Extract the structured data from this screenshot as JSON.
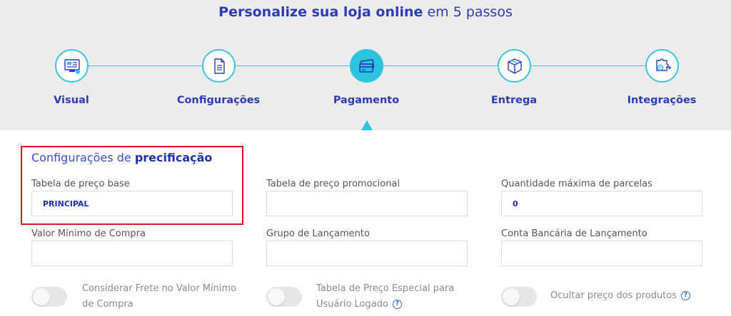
{
  "header": {
    "title_strong": "Personalize sua loja online",
    "title_light": "em 5 passos"
  },
  "steps": [
    {
      "label": "Visual",
      "icon": "visual-icon",
      "active": false
    },
    {
      "label": "Configurações",
      "icon": "document-icon",
      "active": false
    },
    {
      "label": "Pagamento",
      "icon": "payment-icon",
      "active": true
    },
    {
      "label": "Entrega",
      "icon": "box-icon",
      "active": false
    },
    {
      "label": "Integrações",
      "icon": "puzzle-gear-icon",
      "active": false
    }
  ],
  "section": {
    "title_light": "Configurações de",
    "title_strong": "precificação"
  },
  "fields": {
    "tabela_base": {
      "label": "Tabela de preço base",
      "value": "PRINCIPAL"
    },
    "tabela_promo": {
      "label": "Tabela de preço promocional",
      "value": ""
    },
    "parcelas": {
      "label": "Quantidade máxima de parcelas",
      "value": "0"
    },
    "valor_minimo": {
      "label": "Valor Mínimo de Compra",
      "value": ""
    },
    "grupo": {
      "label": "Grupo de Lançamento",
      "value": ""
    },
    "conta": {
      "label": "Conta Bancária de Lançamento",
      "value": ""
    }
  },
  "toggles": {
    "frete": {
      "line1": "Considerar Frete no Valor Mínimo",
      "line2": "de Compra",
      "on": false
    },
    "especial": {
      "line1": "Tabela de Preço Especial para",
      "line2": "Usuário Logado",
      "on": false
    },
    "ocultar": {
      "line1": "Ocultar preço dos produtos",
      "on": false
    }
  },
  "help_glyph": "?",
  "colors": {
    "accent": "#2cc3dc",
    "brand_blue": "#2b3bbd",
    "highlight_red": "#e0101e"
  }
}
